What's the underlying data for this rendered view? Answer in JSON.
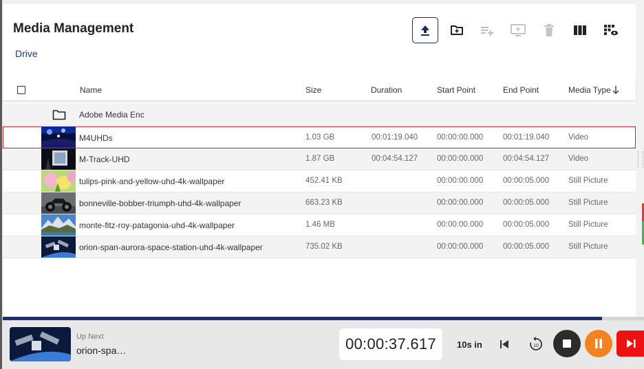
{
  "page": {
    "title": "Media Management",
    "breadcrumb": "Drive"
  },
  "toolbar": [
    {
      "name": "upload-button",
      "icon": "upload-icon",
      "active": true,
      "enabled": true
    },
    {
      "name": "add-folder-button",
      "icon": "folder-plus-icon",
      "enabled": true
    },
    {
      "name": "add-to-playlist-button",
      "icon": "playlist-add-icon",
      "enabled": false
    },
    {
      "name": "send-to-screen-button",
      "icon": "monitor-plus-icon",
      "enabled": false
    },
    {
      "name": "delete-button",
      "icon": "trash-icon",
      "enabled": false
    },
    {
      "name": "column-view-button",
      "icon": "columns-icon",
      "enabled": true
    },
    {
      "name": "grid-preview-button",
      "icon": "grid-eye-icon",
      "enabled": true
    }
  ],
  "table": {
    "columns": {
      "name": "Name",
      "size": "Size",
      "duration": "Duration",
      "start": "Start Point",
      "end": "End Point",
      "type": "Media Type"
    },
    "sort": {
      "column": "type",
      "direction": "descending",
      "icon": "arrow-down-icon"
    },
    "folder": {
      "name": "Adobe Media Enc",
      "icon": "folder-icon"
    },
    "rows": [
      {
        "name": "M4UHDs",
        "size": "1.03 GB",
        "duration": "00:01:19.040",
        "start": "00:00:00.000",
        "end": "00:01:19.040",
        "type": "Video",
        "selected": true
      },
      {
        "name": "M-Track-UHD",
        "size": "1.87 GB",
        "duration": "00:04:54.127",
        "start": "00:00:00.000",
        "end": "00:04:54.127",
        "type": "Video"
      },
      {
        "name": "tulips-pink-and-yellow-uhd-4k-wallpaper",
        "size": "452.41 KB",
        "duration": "",
        "start": "00:00:00.000",
        "end": "00:00:05.000",
        "type": "Still Picture"
      },
      {
        "name": "bonneville-bobber-triumph-uhd-4k-wallpaper",
        "size": "663.23 KB",
        "duration": "",
        "start": "00:00:00.000",
        "end": "00:00:05.000",
        "type": "Still Picture"
      },
      {
        "name": "monte-fitz-roy-patagonia-uhd-4k-wallpaper",
        "size": "1.46 MB",
        "duration": "",
        "start": "00:00:00.000",
        "end": "00:00:05.000",
        "type": "Still Picture"
      },
      {
        "name": "orion-span-aurora-space-station-uhd-4k-wallpaper",
        "size": "735.02 KB",
        "duration": "",
        "start": "00:00:00.000",
        "end": "00:00:05.000",
        "type": "Still Picture"
      }
    ]
  },
  "player": {
    "progress_fraction": 0.935,
    "up_next_label": "Up Next",
    "up_next_name": "orion-spa…",
    "timecode": "00:00:37.617",
    "skip_in": "10s in",
    "controls": [
      "previous-icon",
      "replay-10-icon",
      "stop-icon",
      "pause-icon",
      "skip-next-icon"
    ]
  },
  "colors": {
    "accent_navy": "#1b2f6b",
    "selected_border": "#c0282d",
    "pause_orange": "#f58220",
    "next_red": "#ee1111"
  }
}
